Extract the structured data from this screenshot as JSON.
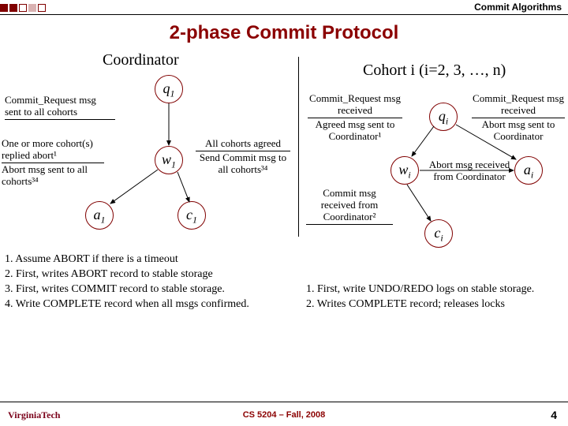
{
  "header": {
    "topic": "Commit Algorithms"
  },
  "title": "2-phase Commit Protocol",
  "subheads": {
    "coordinator": "Coordinator",
    "cohort": "Cohort i (i=2, 3, …, n)"
  },
  "coordinator": {
    "states": {
      "q": "q",
      "w": "w",
      "a": "a",
      "c": "c",
      "sub": "1"
    },
    "trans": {
      "q_to_w": {
        "top": "Commit_Request msg sent to all cohorts",
        "bot": ""
      },
      "w_to_a": {
        "top": "One or more cohort(s) replied abort¹",
        "bot": "Abort msg sent to all cohorts³⁴"
      },
      "w_to_c": {
        "top": "All cohorts agreed",
        "bot": "Send Commit msg to all cohorts³⁴"
      }
    },
    "notes": [
      "1. Assume ABORT if there is a timeout",
      "2. First, writes ABORT record to stable storage",
      "3. First, writes COMMIT record to stable storage.",
      "4. Write COMPLETE record when all msgs confirmed."
    ]
  },
  "cohort": {
    "states": {
      "q": "q",
      "w": "w",
      "a": "a",
      "c": "c",
      "sub": "i"
    },
    "trans": {
      "q_to_w": {
        "top": "Commit_Request msg received",
        "bot": "Agreed msg sent to Coordinator¹"
      },
      "q_to_a": {
        "top": "Commit_Request msg received",
        "bot": "Abort msg sent to Coordinator"
      },
      "w_to_a": {
        "top": "Abort msg received from Coordinator",
        "bot": ""
      },
      "w_to_c": {
        "top": "Commit msg received from Coordinator²",
        "bot": ""
      }
    },
    "notes": [
      "1. First, write UNDO/REDO logs on stable storage.",
      "2. Writes COMPLETE record; releases locks"
    ]
  },
  "footer": {
    "course": "CS 5204 – Fall, 2008",
    "page": "4",
    "logo": "VirginiaTech"
  }
}
